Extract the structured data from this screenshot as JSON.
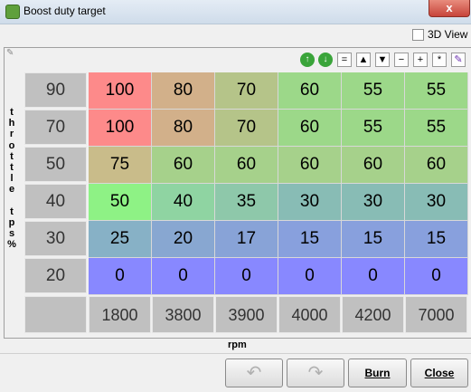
{
  "window": {
    "title": "Boost duty target",
    "close_label": "x"
  },
  "view3d": {
    "label": "3D View",
    "checked": false
  },
  "y_axis": {
    "label": "throttle tps%",
    "values": [
      "90",
      "70",
      "50",
      "40",
      "30",
      "20"
    ]
  },
  "x_axis": {
    "label": "rpm",
    "values": [
      "1800",
      "3800",
      "3900",
      "4000",
      "4200",
      "7000"
    ]
  },
  "table": [
    [
      "100",
      "80",
      "70",
      "60",
      "55",
      "55"
    ],
    [
      "100",
      "80",
      "70",
      "60",
      "55",
      "55"
    ],
    [
      "75",
      "60",
      "60",
      "60",
      "60",
      "60"
    ],
    [
      "50",
      "40",
      "35",
      "30",
      "30",
      "30"
    ],
    [
      "25",
      "20",
      "17",
      "15",
      "15",
      "15"
    ],
    [
      "0",
      "0",
      "0",
      "0",
      "0",
      "0"
    ]
  ],
  "cell_colors": [
    [
      "#fd8a8a",
      "#d2b08a",
      "#b5c489",
      "#9cd889",
      "#9cd889",
      "#9cd889"
    ],
    [
      "#fd8a8a",
      "#d2b08a",
      "#b5c489",
      "#9cd889",
      "#9cd889",
      "#9cd889"
    ],
    [
      "#c9bc8a",
      "#a6d18b",
      "#a6d18b",
      "#a6d18b",
      "#a6d18b",
      "#a6d18b"
    ],
    [
      "#8ef285",
      "#8fd4a2",
      "#8ec8aa",
      "#88bcb5",
      "#88bcb5",
      "#88bcb5"
    ],
    [
      "#87b1c6",
      "#88a7d1",
      "#88a3d7",
      "#88a0dd",
      "#88a0dd",
      "#88a0dd"
    ],
    [
      "#8888ff",
      "#8888ff",
      "#8888ff",
      "#8888ff",
      "#8888ff",
      "#8888ff"
    ]
  ],
  "toolbar": {
    "buttons": [
      "increment",
      "decrement",
      "=",
      "▲",
      "▼",
      "−",
      "+",
      "*",
      "pencil"
    ]
  },
  "buttons": {
    "undo": "↶",
    "redo": "↷",
    "burn": "Burn",
    "close": "Close"
  }
}
